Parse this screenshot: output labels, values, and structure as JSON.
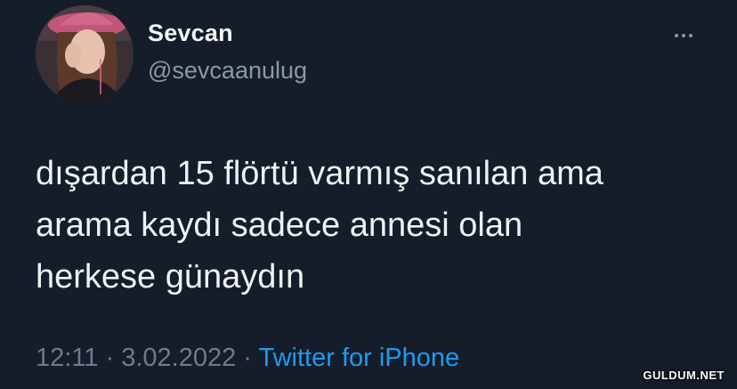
{
  "user": {
    "display_name": "Sevcan",
    "handle": "@sevcaanulug"
  },
  "tweet": {
    "text_lines": [
      "dışardan 15 flörtü varmış sanılan ama",
      "arama kaydı sadece annesi olan",
      "herkese günaydın"
    ]
  },
  "meta": {
    "time": "12:11",
    "separator": "·",
    "date": "3.02.2022",
    "source": "Twitter for iPhone"
  },
  "more_menu_icon": "ellipsis-icon",
  "watermark": "GULDUM.NET",
  "colors": {
    "background": "#151d2a",
    "text": "#eef1f3",
    "muted": "#8b98a5",
    "link": "#1d9bf0"
  }
}
